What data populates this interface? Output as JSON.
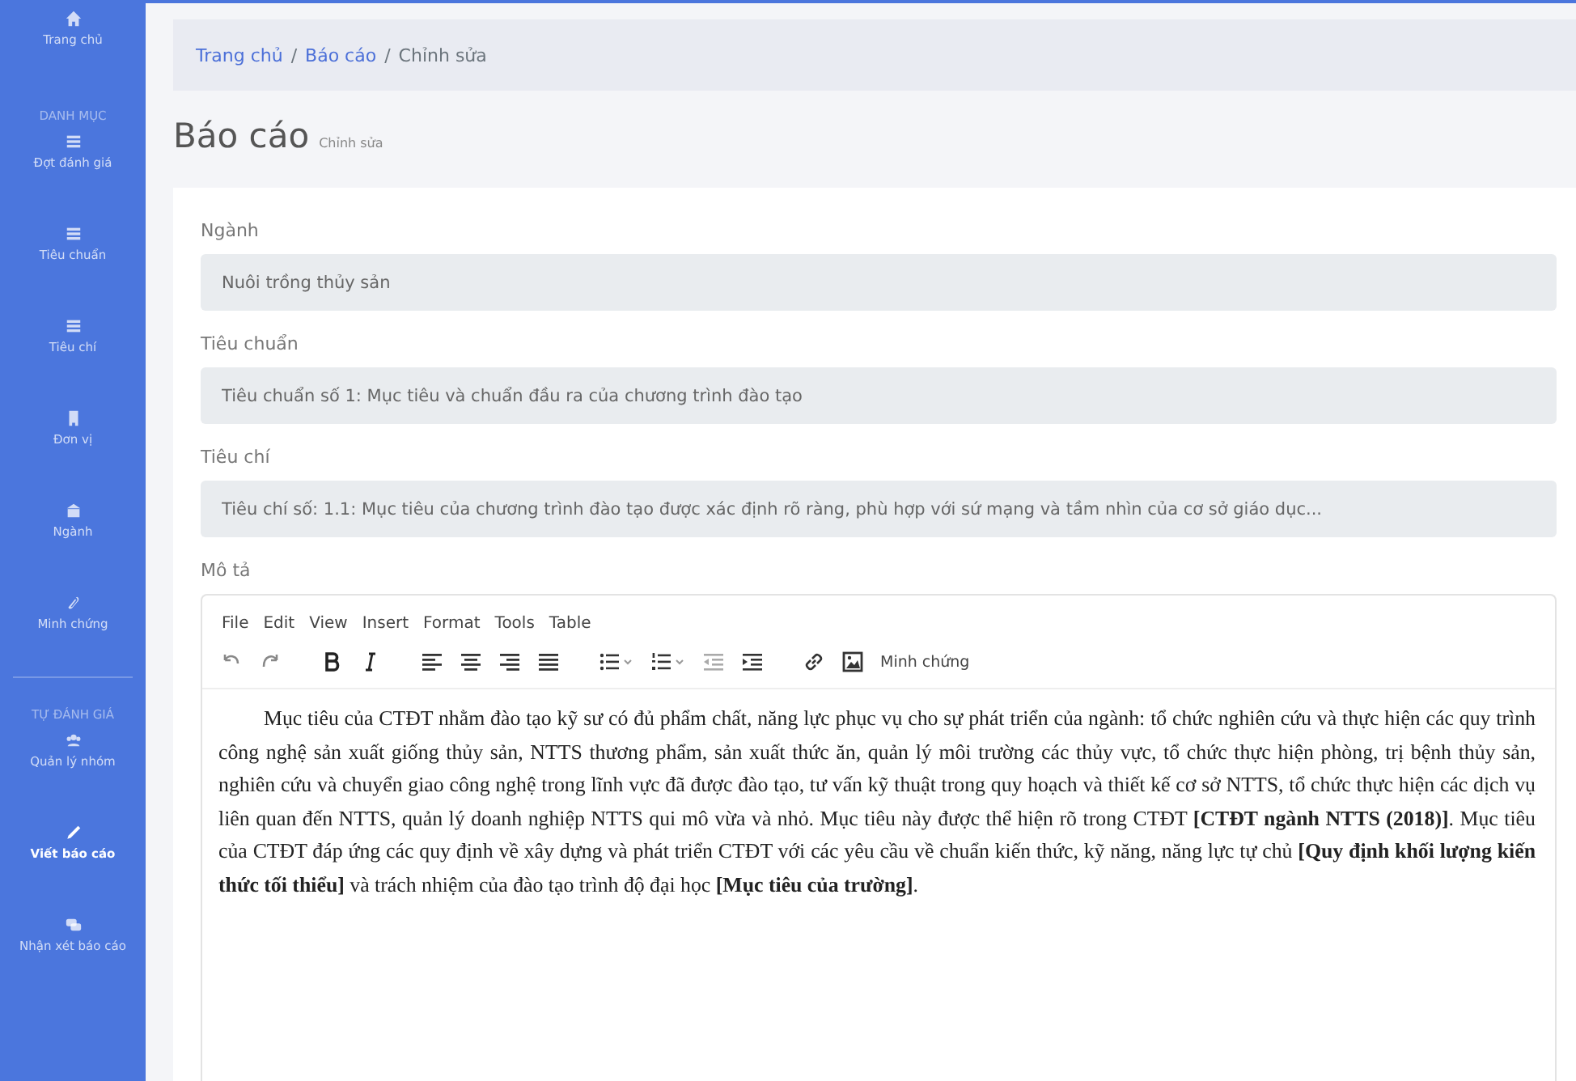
{
  "sidebar": {
    "items": [
      {
        "kind": "link",
        "label": "Trang chủ",
        "selected": false
      },
      {
        "kind": "header",
        "label": "DANH MỤC"
      },
      {
        "kind": "link",
        "label": "Đợt đánh giá",
        "selected": false
      },
      {
        "kind": "link",
        "label": "Tiêu chuẩn",
        "selected": false
      },
      {
        "kind": "link",
        "label": "Tiêu chí",
        "selected": false
      },
      {
        "kind": "link",
        "label": "Đơn vị",
        "selected": false
      },
      {
        "kind": "link",
        "label": "Ngành",
        "selected": false
      },
      {
        "kind": "link",
        "label": "Minh chứng",
        "selected": false
      },
      {
        "kind": "divider"
      },
      {
        "kind": "header",
        "label": "TỰ ĐÁNH GIÁ"
      },
      {
        "kind": "link",
        "label": "Quản lý nhóm",
        "selected": false
      },
      {
        "kind": "link",
        "label": "Viết báo cáo",
        "selected": true
      },
      {
        "kind": "link",
        "label": "Nhận xét báo cáo",
        "selected": false
      }
    ]
  },
  "breadcrumb": {
    "separator": "/",
    "items": [
      {
        "label": "Trang chủ",
        "link": true
      },
      {
        "label": "Báo cáo",
        "link": true
      },
      {
        "label": "Chỉnh sửa",
        "link": false
      }
    ]
  },
  "page_title": "Báo cáo",
  "page_subtitle": "Chỉnh sửa",
  "fields": [
    {
      "label": "Ngành",
      "value": "Nuôi trồng thủy sản"
    },
    {
      "label": "Tiêu chuẩn",
      "value": "Tiêu chuẩn số 1: Mục tiêu và chuẩn đầu ra của chương trình đào tạo"
    },
    {
      "label": "Tiêu chí",
      "value": "Tiêu chí số: 1.1: Mục tiêu của chương trình đào tạo được xác định rõ ràng, phù hợp với sứ mạng và tầm nhìn của cơ sở giáo dục..."
    }
  ],
  "editor": {
    "label": "Mô tả",
    "menu": [
      "File",
      "Edit",
      "View",
      "Insert",
      "Format",
      "Tools",
      "Table"
    ],
    "custom_button": "Minh chứng",
    "content": "Mục tiêu của CTĐT nhằm đào tạo kỹ sư có đủ phẩm chất, năng lực phục vụ cho sự phát triển của ngành: tổ chức nghiên cứu và thực hiện các quy trình công nghệ sản xuất giống thủy sản, NTTS thương phẩm, sản xuất thức ăn, quản lý môi trường các thủy vực, tổ chức thực hiện phòng, trị bệnh thủy sản, nghiên cứu và chuyển giao công nghệ trong lĩnh vực đã được đào tạo, tư vấn kỹ thuật trong quy hoạch và thiết kế cơ sở NTTS, tổ chức thực hiện các dịch vụ liên quan đến NTTS, quản lý doanh nghiệp NTTS qui mô vừa và nhỏ. Mục tiêu này được thể hiện rõ trong CTĐT **[CTĐT ngành NTTS (2018)]**. Mục tiêu của CTĐT đáp ứng các quy định về xây dựng và phát triển CTĐT với các yêu cầu về chuẩn kiến thức, kỹ năng, năng lực tự chủ **[Quy định khối lượng kiến thức tối thiểu]** và trách nhiệm của đào tạo trình độ đại học **[Mục tiêu của trường]**."
  }
}
